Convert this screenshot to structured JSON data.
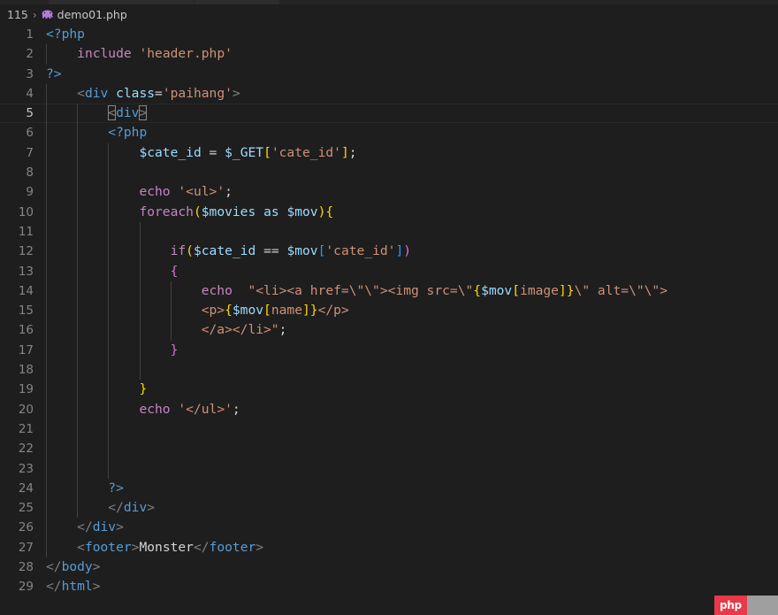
{
  "window": {
    "background_color": "#1e1e1e",
    "tabs": [
      {
        "name": "tab-partial-1",
        "label": ""
      },
      {
        "name": "tab-partial-2",
        "label": ""
      }
    ]
  },
  "breadcrumb": {
    "root": "115",
    "separator": "›",
    "icon": "php-elephant-icon",
    "file": "demo01.php"
  },
  "editor": {
    "language": "php",
    "active_line": 5,
    "total_lines": 29,
    "gutter_color": "#858585",
    "lines": [
      {
        "num": "1",
        "indent_guides": 0,
        "tokens": [
          {
            "c": "t-php-tag",
            "t": "<?php"
          }
        ]
      },
      {
        "num": "2",
        "indent_guides": 1,
        "tokens": [
          {
            "c": "t-plain",
            "t": "    "
          },
          {
            "c": "t-keyword",
            "t": "include"
          },
          {
            "c": "t-plain",
            "t": " "
          },
          {
            "c": "t-string",
            "t": "'header.php'"
          }
        ]
      },
      {
        "num": "3",
        "indent_guides": 0,
        "tokens": [
          {
            "c": "t-php-tag",
            "t": "?>"
          }
        ]
      },
      {
        "num": "4",
        "indent_guides": 1,
        "tokens": [
          {
            "c": "t-plain",
            "t": "    "
          },
          {
            "c": "t-tagbrack",
            "t": "<"
          },
          {
            "c": "t-tagname",
            "t": "div"
          },
          {
            "c": "t-plain",
            "t": " "
          },
          {
            "c": "t-var",
            "t": "class"
          },
          {
            "c": "t-plain",
            "t": "="
          },
          {
            "c": "t-string",
            "t": "'paihang'"
          },
          {
            "c": "t-tagbrack",
            "t": ">"
          }
        ]
      },
      {
        "num": "5",
        "indent_guides": 2,
        "tokens": [
          {
            "c": "t-plain",
            "t": "        "
          },
          {
            "c": "t-tagbrack bracket-match",
            "t": "<"
          },
          {
            "c": "t-tagname",
            "t": "div"
          },
          {
            "c": "t-tagbrack bracket-match",
            "t": ">"
          }
        ]
      },
      {
        "num": "6",
        "indent_guides": 2,
        "tokens": [
          {
            "c": "t-plain",
            "t": "        "
          },
          {
            "c": "t-php-tag",
            "t": "<?php"
          }
        ]
      },
      {
        "num": "7",
        "indent_guides": 3,
        "tokens": [
          {
            "c": "t-plain",
            "t": "            "
          },
          {
            "c": "t-var",
            "t": "$cate_id"
          },
          {
            "c": "t-plain",
            "t": " "
          },
          {
            "c": "t-op",
            "t": "="
          },
          {
            "c": "t-plain",
            "t": " "
          },
          {
            "c": "t-var",
            "t": "$_GET"
          },
          {
            "c": "t-b1",
            "t": "["
          },
          {
            "c": "t-string",
            "t": "'cate_id'"
          },
          {
            "c": "t-b1",
            "t": "]"
          },
          {
            "c": "t-plain",
            "t": ";"
          }
        ]
      },
      {
        "num": "8",
        "indent_guides": 3,
        "tokens": []
      },
      {
        "num": "9",
        "indent_guides": 3,
        "tokens": [
          {
            "c": "t-plain",
            "t": "            "
          },
          {
            "c": "t-keyword",
            "t": "echo"
          },
          {
            "c": "t-plain",
            "t": " "
          },
          {
            "c": "t-string",
            "t": "'<ul>'"
          },
          {
            "c": "t-plain",
            "t": ";"
          }
        ]
      },
      {
        "num": "10",
        "indent_guides": 3,
        "tokens": [
          {
            "c": "t-plain",
            "t": "            "
          },
          {
            "c": "t-keyword",
            "t": "foreach"
          },
          {
            "c": "t-b1",
            "t": "("
          },
          {
            "c": "t-var",
            "t": "$movies"
          },
          {
            "c": "t-plain",
            "t": " "
          },
          {
            "c": "t-var",
            "t": "as"
          },
          {
            "c": "t-plain",
            "t": " "
          },
          {
            "c": "t-var",
            "t": "$mov"
          },
          {
            "c": "t-b1",
            "t": ")"
          },
          {
            "c": "t-b1",
            "t": "{"
          }
        ]
      },
      {
        "num": "11",
        "indent_guides": 4,
        "tokens": []
      },
      {
        "num": "12",
        "indent_guides": 4,
        "tokens": [
          {
            "c": "t-plain",
            "t": "                "
          },
          {
            "c": "t-keyword",
            "t": "if"
          },
          {
            "c": "t-b1",
            "t": "("
          },
          {
            "c": "t-var",
            "t": "$cate_id"
          },
          {
            "c": "t-plain",
            "t": " "
          },
          {
            "c": "t-op",
            "t": "=="
          },
          {
            "c": "t-plain",
            "t": " "
          },
          {
            "c": "t-var",
            "t": "$mov"
          },
          {
            "c": "t-b3",
            "t": "["
          },
          {
            "c": "t-string",
            "t": "'cate_id'"
          },
          {
            "c": "t-b3",
            "t": "]"
          },
          {
            "c": "t-b2",
            "t": ")"
          }
        ]
      },
      {
        "num": "13",
        "indent_guides": 4,
        "tokens": [
          {
            "c": "t-plain",
            "t": "                "
          },
          {
            "c": "t-b2",
            "t": "{"
          }
        ]
      },
      {
        "num": "14",
        "indent_guides": 5,
        "tokens": [
          {
            "c": "t-plain",
            "t": "                    "
          },
          {
            "c": "t-keyword",
            "t": "echo"
          },
          {
            "c": "t-plain",
            "t": "  "
          },
          {
            "c": "t-string",
            "t": "\"<li><a href=\\\"\\\"><img src=\\\""
          },
          {
            "c": "t-b1",
            "t": "{"
          },
          {
            "c": "t-var",
            "t": "$mov"
          },
          {
            "c": "t-b1",
            "t": "["
          },
          {
            "c": "t-string",
            "t": "image"
          },
          {
            "c": "t-b1",
            "t": "]"
          },
          {
            "c": "t-b1",
            "t": "}"
          },
          {
            "c": "t-string",
            "t": "\\\" alt=\\\"\\\">"
          }
        ]
      },
      {
        "num": "15",
        "indent_guides": 5,
        "tokens": [
          {
            "c": "t-plain",
            "t": "                    "
          },
          {
            "c": "t-string",
            "t": "<p>"
          },
          {
            "c": "t-b1",
            "t": "{"
          },
          {
            "c": "t-var",
            "t": "$mov"
          },
          {
            "c": "t-b1",
            "t": "["
          },
          {
            "c": "t-string",
            "t": "name"
          },
          {
            "c": "t-b1",
            "t": "]"
          },
          {
            "c": "t-b1",
            "t": "}"
          },
          {
            "c": "t-string",
            "t": "</p>"
          }
        ]
      },
      {
        "num": "16",
        "indent_guides": 5,
        "tokens": [
          {
            "c": "t-plain",
            "t": "                    "
          },
          {
            "c": "t-string",
            "t": "</a></li>\""
          },
          {
            "c": "t-plain",
            "t": ";"
          }
        ]
      },
      {
        "num": "17",
        "indent_guides": 4,
        "tokens": [
          {
            "c": "t-plain",
            "t": "                "
          },
          {
            "c": "t-b2",
            "t": "}"
          }
        ]
      },
      {
        "num": "18",
        "indent_guides": 4,
        "tokens": []
      },
      {
        "num": "19",
        "indent_guides": 3,
        "tokens": [
          {
            "c": "t-plain",
            "t": "            "
          },
          {
            "c": "t-b1",
            "t": "}"
          }
        ]
      },
      {
        "num": "20",
        "indent_guides": 3,
        "tokens": [
          {
            "c": "t-plain",
            "t": "            "
          },
          {
            "c": "t-keyword",
            "t": "echo"
          },
          {
            "c": "t-plain",
            "t": " "
          },
          {
            "c": "t-string",
            "t": "'</ul>'"
          },
          {
            "c": "t-plain",
            "t": ";"
          }
        ]
      },
      {
        "num": "21",
        "indent_guides": 3,
        "tokens": []
      },
      {
        "num": "22",
        "indent_guides": 3,
        "tokens": []
      },
      {
        "num": "23",
        "indent_guides": 3,
        "tokens": []
      },
      {
        "num": "24",
        "indent_guides": 2,
        "tokens": [
          {
            "c": "t-plain",
            "t": "        "
          },
          {
            "c": "t-php-tag",
            "t": "?>"
          }
        ]
      },
      {
        "num": "25",
        "indent_guides": 2,
        "tokens": [
          {
            "c": "t-plain",
            "t": "        "
          },
          {
            "c": "t-tagbrack",
            "t": "</"
          },
          {
            "c": "t-tagname",
            "t": "div"
          },
          {
            "c": "t-tagbrack",
            "t": ">"
          }
        ]
      },
      {
        "num": "26",
        "indent_guides": 1,
        "tokens": [
          {
            "c": "t-plain",
            "t": "    "
          },
          {
            "c": "t-tagbrack",
            "t": "</"
          },
          {
            "c": "t-tagname",
            "t": "div"
          },
          {
            "c": "t-tagbrack",
            "t": ">"
          }
        ]
      },
      {
        "num": "27",
        "indent_guides": 1,
        "tokens": [
          {
            "c": "t-plain",
            "t": "    "
          },
          {
            "c": "t-tagbrack",
            "t": "<"
          },
          {
            "c": "t-tagname",
            "t": "footer"
          },
          {
            "c": "t-tagbrack",
            "t": ">"
          },
          {
            "c": "t-text",
            "t": "Monster"
          },
          {
            "c": "t-tagbrack",
            "t": "</"
          },
          {
            "c": "t-tagname",
            "t": "footer"
          },
          {
            "c": "t-tagbrack",
            "t": ">"
          }
        ]
      },
      {
        "num": "28",
        "indent_guides": 0,
        "tokens": [
          {
            "c": "t-tagbrack",
            "t": "</"
          },
          {
            "c": "t-tagname",
            "t": "body"
          },
          {
            "c": "t-tagbrack",
            "t": ">"
          }
        ]
      },
      {
        "num": "29",
        "indent_guides": 0,
        "tokens": [
          {
            "c": "t-tagbrack",
            "t": "</"
          },
          {
            "c": "t-tagname",
            "t": "html"
          },
          {
            "c": "t-tagbrack",
            "t": ">"
          }
        ]
      }
    ]
  },
  "status_badge": {
    "label": "php",
    "accent_color": "#e8394a",
    "tail_color": "#9f9f9f"
  }
}
